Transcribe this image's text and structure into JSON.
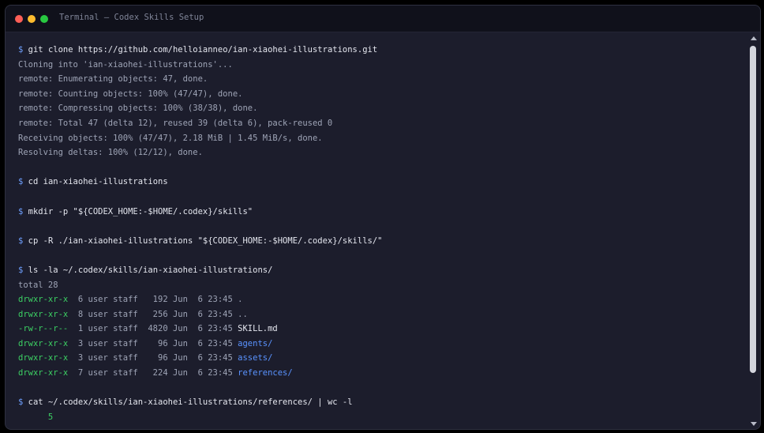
{
  "window": {
    "title": "Terminal — Codex Skills Setup"
  },
  "terminal": {
    "prompt": "$",
    "clone": {
      "command": "git clone https://github.com/helloianneo/ian-xiaohei-illustrations.git",
      "output": [
        "Cloning into 'ian-xiaohei-illustrations'...",
        "remote: Enumerating objects: 47, done.",
        "remote: Counting objects: 100% (47/47), done.",
        "remote: Compressing objects: 100% (38/38), done.",
        "remote: Total 47 (delta 12), reused 39 (delta 6), pack-reused 0",
        "Receiving objects: 100% (47/47), 2.18 MiB | 1.45 MiB/s, done.",
        "Resolving deltas: 100% (12/12), done."
      ]
    },
    "cd": {
      "command": "cd ian-xiaohei-illustrations"
    },
    "mkdir": {
      "command": "mkdir -p \"${CODEX_HOME:-$HOME/.codex}/skills\""
    },
    "cp": {
      "command": "cp -R ./ian-xiaohei-illustrations \"${CODEX_HOME:-$HOME/.codex}/skills/\""
    },
    "ls": {
      "command": "ls -la ~/.codex/skills/ian-xiaohei-illustrations/",
      "total": "total 28",
      "rows": [
        {
          "perms": "drwxr-xr-x",
          "meta": "  6 user staff   192 Jun  6 23:45 ",
          "name": "."
        },
        {
          "perms": "drwxr-xr-x",
          "meta": "  8 user staff   256 Jun  6 23:45 ",
          "name": ".."
        },
        {
          "perms": "-rw-r--r--",
          "meta": "  1 user staff  4820 Jun  6 23:45 ",
          "name": "SKILL.md"
        },
        {
          "perms": "drwxr-xr-x",
          "meta": "  3 user staff    96 Jun  6 23:45 ",
          "name": "agents/"
        },
        {
          "perms": "drwxr-xr-x",
          "meta": "  3 user staff    96 Jun  6 23:45 ",
          "name": "assets/"
        },
        {
          "perms": "drwxr-xr-x",
          "meta": "  7 user staff   224 Jun  6 23:45 ",
          "name": "references/"
        }
      ]
    },
    "cat": {
      "command": "cat ~/.codex/skills/ian-xiaohei-illustrations/references/ | wc -l",
      "output": "      5"
    }
  },
  "colors": {
    "prompt": "#6fa0ff",
    "command": "#e4e6ee",
    "output": "#9ea4b6",
    "permissions": "#3ccf63",
    "directory": "#5a93ff",
    "background": "#1c1d2c"
  }
}
